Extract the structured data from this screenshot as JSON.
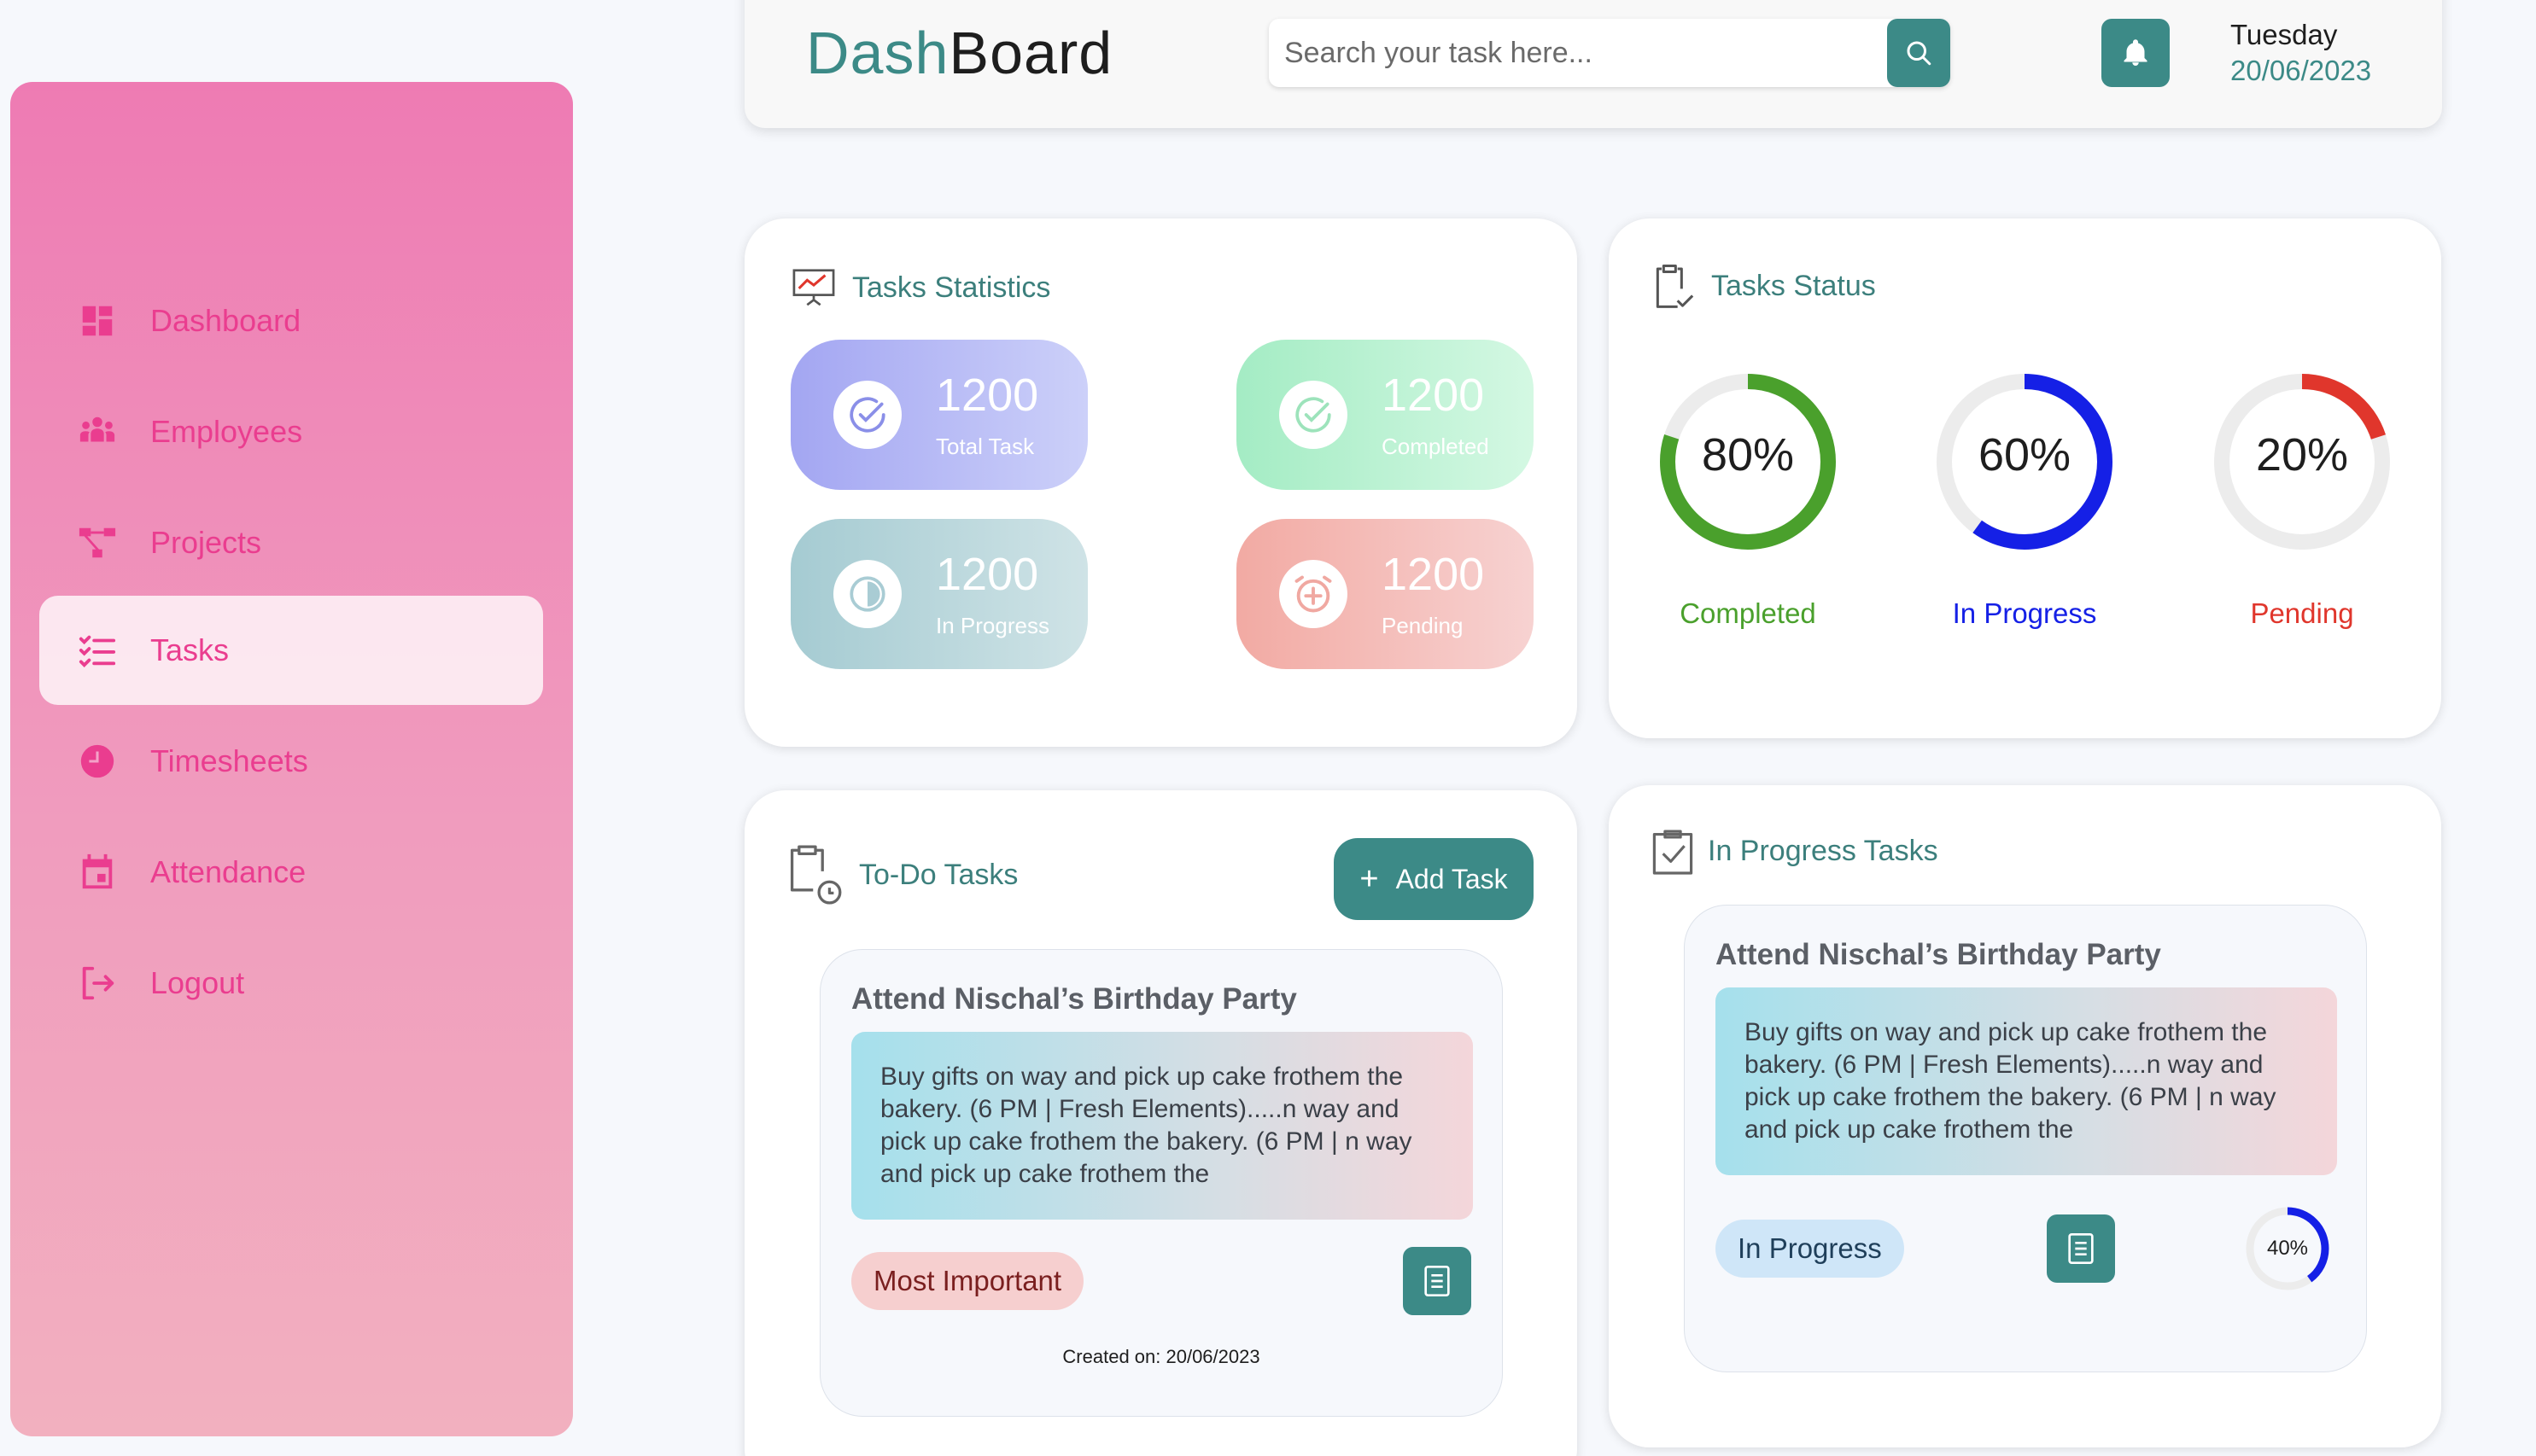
{
  "sidebar": {
    "items": [
      {
        "label": "Dashboard",
        "icon": "dashboard-icon"
      },
      {
        "label": "Employees",
        "icon": "employees-icon"
      },
      {
        "label": "Projects",
        "icon": "projects-icon"
      },
      {
        "label": "Tasks",
        "icon": "tasks-icon",
        "active": true
      },
      {
        "label": "Timesheets",
        "icon": "timesheets-icon"
      },
      {
        "label": "Attendance",
        "icon": "attendance-icon"
      },
      {
        "label": "Logout",
        "icon": "logout-icon"
      }
    ]
  },
  "header": {
    "brand_part1": "Dash",
    "brand_part2": "Board",
    "search_placeholder": "Search your task here...",
    "day": "Tuesday",
    "date": "20/06/2023"
  },
  "colors": {
    "accent": "#3c8a87",
    "sidebar_text": "#ea3d8f",
    "completed": "#4aa02c",
    "in_progress": "#1520e6",
    "pending": "#e0362c"
  },
  "statistics": {
    "title": "Tasks Statistics",
    "items": [
      {
        "value": "1200",
        "label": "Total Task"
      },
      {
        "value": "1200",
        "label": "Completed"
      },
      {
        "value": "1200",
        "label": "In Progress"
      },
      {
        "value": "1200",
        "label": "Pending"
      }
    ]
  },
  "status": {
    "title": "Tasks Status",
    "items": [
      {
        "percent": 80,
        "text": "80%",
        "label": "Completed"
      },
      {
        "percent": 60,
        "text": "60%",
        "label": "In Progress"
      },
      {
        "percent": 20,
        "text": "20%",
        "label": "Pending"
      }
    ]
  },
  "todo": {
    "title": "To-Do Tasks",
    "add_label": "Add Task",
    "task": {
      "title": "Attend Nischal’s Birthday Party",
      "description": "Buy gifts on way and pick up cake frothem the bakery. (6 PM | Fresh Elements).....n way and pick up cake frothem the bakery. (6 PM | n way and pick up cake frothem the",
      "priority": "Most Important",
      "created": "Created on: 20/06/2023"
    }
  },
  "inprogress": {
    "title": "In Progress Tasks",
    "task": {
      "title": "Attend Nischal’s Birthday Party",
      "description": "Buy gifts on way and pick up cake frothem the bakery. (6 PM | Fresh Elements).....n way and pick up cake frothem the bakery. (6 PM | n way and pick up cake frothem the",
      "status": "In Progress",
      "progress_percent": 40,
      "progress_text": "40%"
    }
  }
}
